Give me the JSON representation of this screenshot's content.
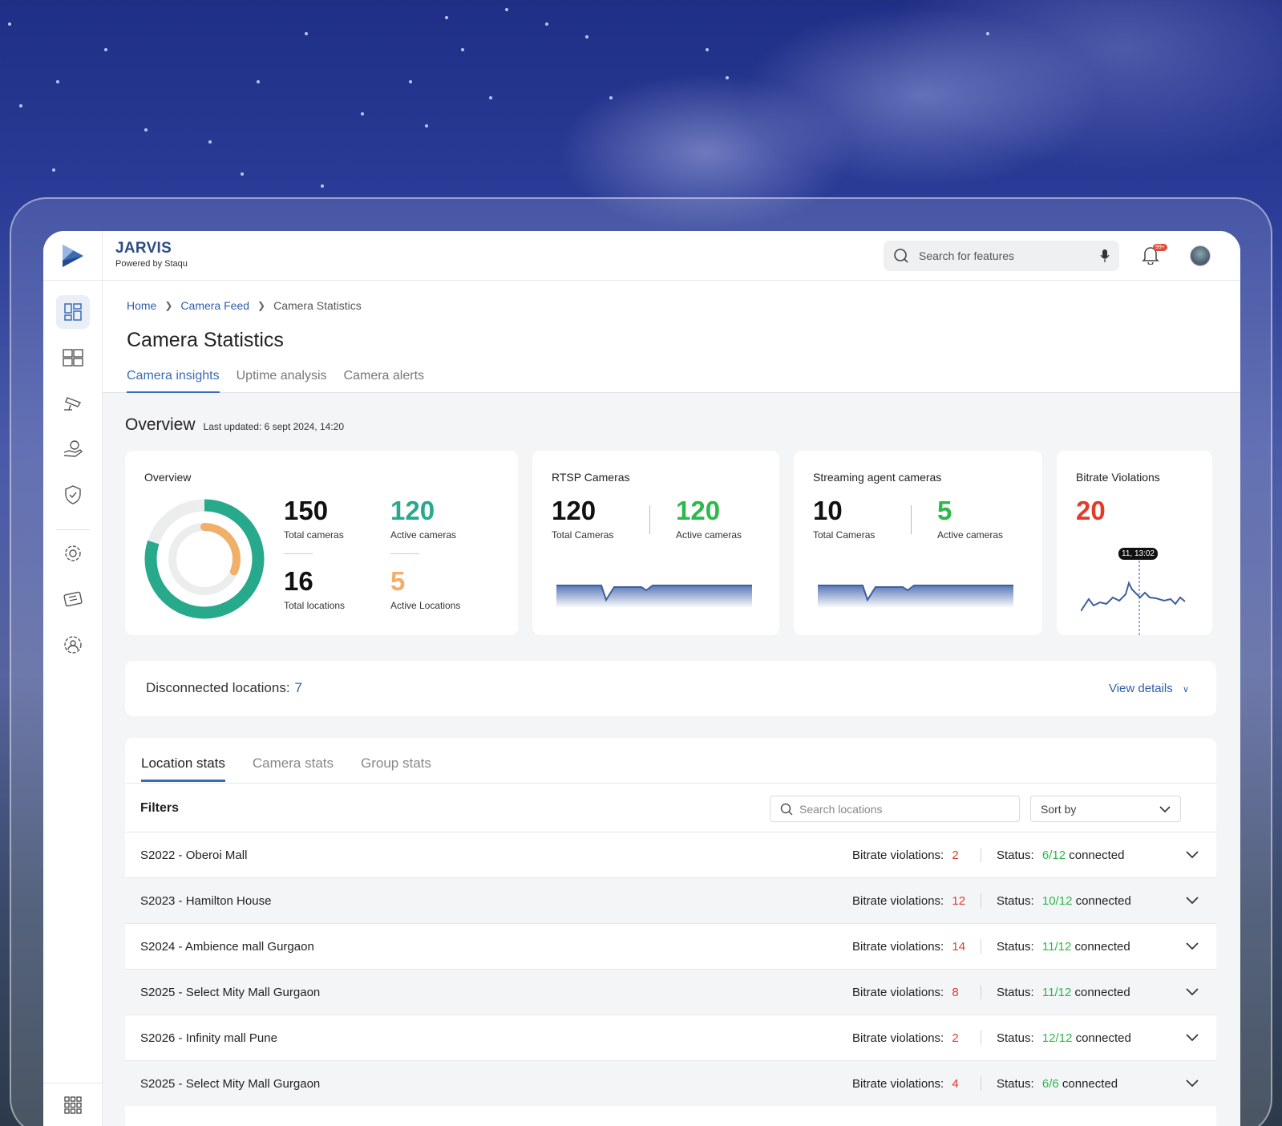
{
  "brand": {
    "title": "JARVIS",
    "subtitle": "Powered by Staqu"
  },
  "search": {
    "placeholder": "Search for features"
  },
  "notifications": {
    "badge": "99+"
  },
  "breadcrumb": [
    "Home",
    "Camera Feed",
    "Camera Statistics"
  ],
  "page": {
    "title": "Camera Statistics"
  },
  "tabs": [
    "Camera insights",
    "Uptime analysis",
    "Camera alerts"
  ],
  "overview": {
    "title": "Overview",
    "last_updated": "Last updated: 6 sept 2024, 14:20"
  },
  "cards": {
    "overview": {
      "title": "Overview",
      "total_cameras": "150",
      "total_cameras_label": "Total cameras",
      "active_cameras": "120",
      "active_cameras_label": "Active cameras",
      "total_locations": "16",
      "total_locations_label": "Total locations",
      "active_locations": "5",
      "active_locations_label": "Active Locations",
      "donut": {
        "outer_fraction": 0.8,
        "inner_fraction": 0.3125
      }
    },
    "rtsp": {
      "title": "RTSP Cameras",
      "total": "120",
      "total_label": "Total Cameras",
      "active": "120",
      "active_label": "Active cameras"
    },
    "streaming": {
      "title": "Streaming agent cameras",
      "total": "10",
      "total_label": "Total Cameras",
      "active": "5",
      "active_label": "Active cameras"
    },
    "bitrate": {
      "title": "Bitrate Violations",
      "value": "20",
      "tooltip": "11, 13:02"
    }
  },
  "disconnected": {
    "label": "Disconnected locations:",
    "value": "7",
    "link": "View details"
  },
  "stat_tabs": [
    "Location stats",
    "Camera stats",
    "Group stats"
  ],
  "filters": {
    "label": "Filters",
    "search_placeholder": "Search locations",
    "sort_label": "Sort by"
  },
  "rows": [
    {
      "name": "S2022 - Oberoi Mall",
      "bv_label": "Bitrate violations:",
      "bv": "2",
      "status_label": "Status:",
      "status": "6/12",
      "status_suffix": "connected"
    },
    {
      "name": "S2023 - Hamilton House",
      "bv_label": "Bitrate violations:",
      "bv": "12",
      "status_label": "Status:",
      "status": "10/12",
      "status_suffix": "connected"
    },
    {
      "name": "S2024 -  Ambience mall Gurgaon",
      "bv_label": "Bitrate violations:",
      "bv": "14",
      "status_label": "Status:",
      "status": "11/12",
      "status_suffix": "connected"
    },
    {
      "name": "S2025 - Select Mity Mall Gurgaon",
      "bv_label": "Bitrate violations:",
      "bv": "8",
      "status_label": "Status:",
      "status": "11/12",
      "status_suffix": "connected"
    },
    {
      "name": "S2026 - Infinity mall Pune",
      "bv_label": "Bitrate violations:",
      "bv": "2",
      "status_label": "Status:",
      "status": "12/12",
      "status_suffix": "connected"
    },
    {
      "name": "S2025 - Select Mity Mall Gurgaon",
      "bv_label": "Bitrate violations:",
      "bv": "4",
      "status_label": "Status:",
      "status": "6/6",
      "status_suffix": "connected"
    }
  ],
  "colors": {
    "accent": "#3a6bb5",
    "teal": "#27a98c",
    "green": "#2db84a",
    "orange": "#f0b06a",
    "red": "#e23b2b"
  }
}
